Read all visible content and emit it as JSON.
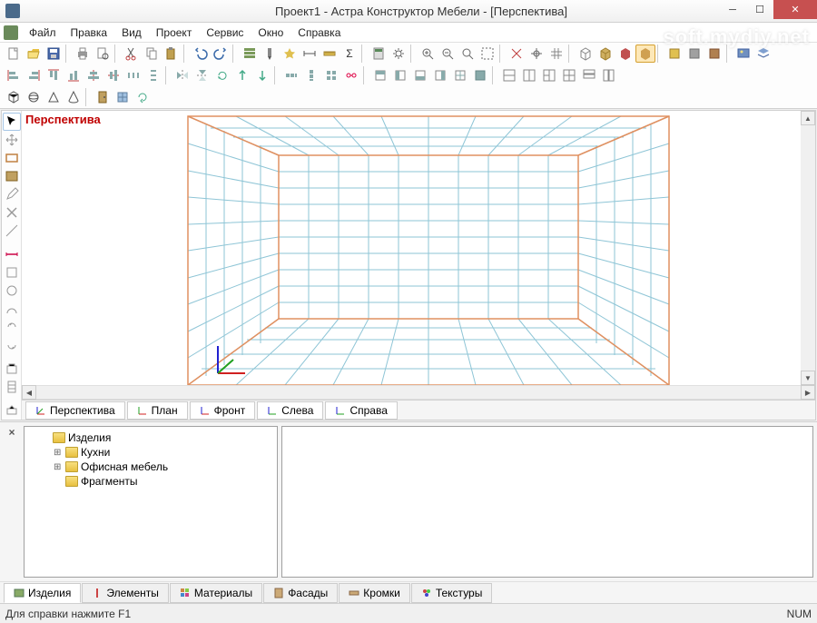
{
  "title": "Проект1 - Астра Конструктор Мебели - [Перспектива]",
  "watermark": "soft.mydiy.net",
  "menu": {
    "file": "Файл",
    "edit": "Правка",
    "view": "Вид",
    "project": "Проект",
    "service": "Сервис",
    "window": "Окно",
    "help": "Справка"
  },
  "viewport_label": "Перспектива",
  "view_tabs": {
    "perspective": "Перспектива",
    "plan": "План",
    "front": "Фронт",
    "left": "Слева",
    "right": "Справа"
  },
  "tree": {
    "root": "Изделия",
    "items": [
      "Кухни",
      "Офисная мебель",
      "Фрагменты"
    ]
  },
  "bottom_tabs": {
    "products": "Изделия",
    "elements": "Элементы",
    "materials": "Материалы",
    "facades": "Фасады",
    "edges": "Кромки",
    "textures": "Текстуры"
  },
  "status": {
    "help": "Для справки нажмите F1",
    "num": "NUM"
  },
  "colors": {
    "grid": "#8ec5d6",
    "room_edge": "#e09060",
    "axis_x": "#d02020",
    "axis_y": "#20a020",
    "axis_z": "#2020d0"
  }
}
